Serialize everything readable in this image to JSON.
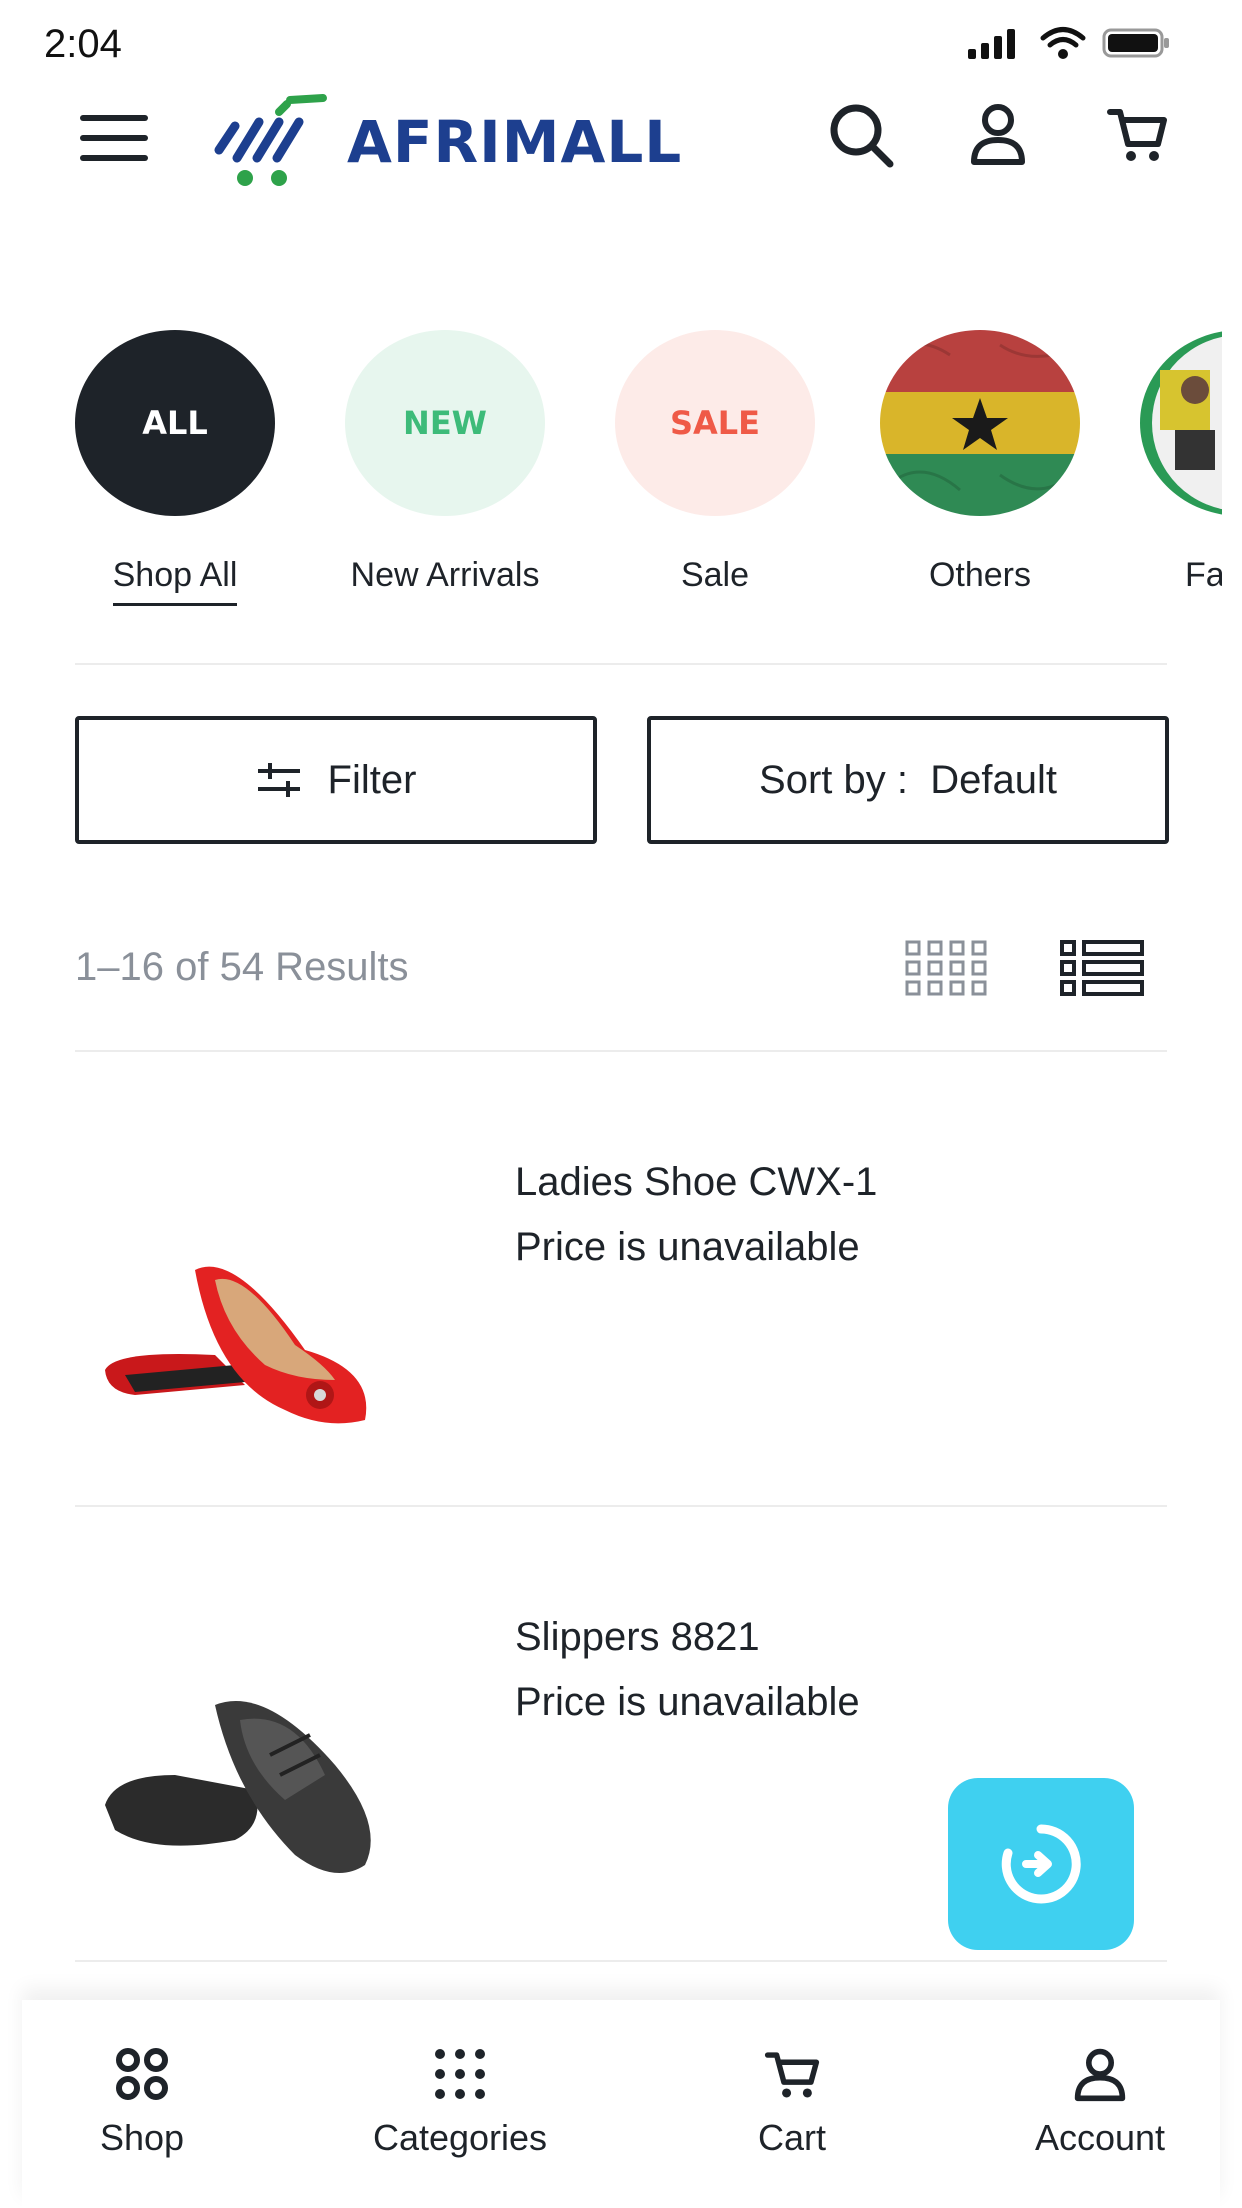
{
  "status_bar": {
    "time": "2:04"
  },
  "header": {
    "logo_text": "AFRIMALL",
    "brand_blue": "#1d3f8f",
    "brand_green": "#2ea24a",
    "icons": [
      "menu-icon",
      "search-icon",
      "user-icon",
      "cart-icon"
    ]
  },
  "categories": [
    {
      "badge": "ALL",
      "label": "Shop All",
      "bg": "#1e2329",
      "fg": "#ffffff",
      "active": true
    },
    {
      "badge": "NEW",
      "label": "New Arrivals",
      "bg": "#e7f6ee",
      "fg": "#3dbb79"
    },
    {
      "badge": "SALE",
      "label": "Sale",
      "bg": "#fdebe8",
      "fg": "#ef5a47"
    },
    {
      "badge": "",
      "label": "Others",
      "image": "ghana-flag"
    },
    {
      "badge": "",
      "label": "Fa",
      "image": "fashion-photo"
    }
  ],
  "controls": {
    "filter_label": "Filter",
    "sort_label": "Sort by :  Default"
  },
  "results": {
    "text": "1–16 of 54 Results"
  },
  "products": [
    {
      "name": "Ladies Shoe CWX-1",
      "price": "Price is unavailable",
      "image": "red-flat-shoe"
    },
    {
      "name": "Slippers 8821",
      "price": "Price is unavailable",
      "image": "black-slippers"
    }
  ],
  "fab": {
    "icon": "refresh-arrow-icon",
    "color": "#3fd0f0"
  },
  "bottom_nav": [
    {
      "label": "Shop",
      "icon": "shop-icon"
    },
    {
      "label": "Categories",
      "icon": "grid-dots-icon"
    },
    {
      "label": "Cart",
      "icon": "cart-icon"
    },
    {
      "label": "Account",
      "icon": "account-icon"
    }
  ]
}
